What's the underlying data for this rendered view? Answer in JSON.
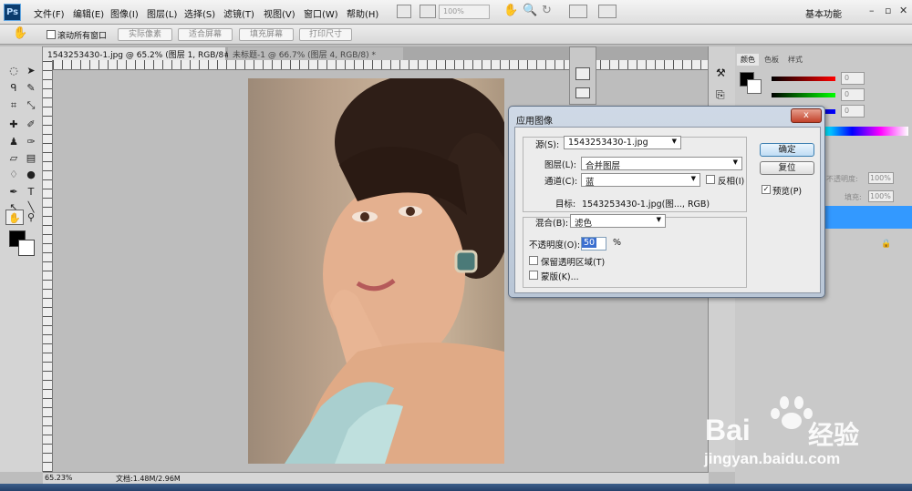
{
  "app": {
    "logo": "Ps",
    "workspace": "基本功能"
  },
  "menu": [
    "文件(F)",
    "编辑(E)",
    "图像(I)",
    "图层(L)",
    "选择(S)",
    "滤镜(T)",
    "视图(V)",
    "窗口(W)",
    "帮助(H)"
  ],
  "toolbar": {
    "zoom": "100%"
  },
  "options": {
    "scroll_all": "滚动所有窗口",
    "actual_pixels": "实际像素",
    "fit_screen": "适合屏幕",
    "fill_screen": "填充屏幕",
    "print_size": "打印尺寸"
  },
  "tabs": [
    {
      "label": "1543253430-1.jpg @ 65.2% (图层 1, RGB/8#) *"
    },
    {
      "label": "未标题-1 @ 66.7% (图层 4, RGB/8) *"
    }
  ],
  "status": {
    "zoom": "65.23%",
    "doc": "文档:1.48M/2.96M"
  },
  "panel": {
    "tabs": [
      "颜色",
      "色板",
      "样式"
    ],
    "values": [
      "0",
      "0",
      "0"
    ],
    "opacity_label": "不透明度:",
    "opacity_value": "100%",
    "fill_label": "填充:",
    "fill_value": "100%"
  },
  "dialog": {
    "title": "应用图像",
    "close": "x",
    "source_label": "源(S):",
    "source_value": "1543253430-1.jpg",
    "layer_label": "图层(L):",
    "layer_value": "合并图层",
    "channel_label": "通道(C):",
    "channel_value": "蓝",
    "invert_label": "反相(I)",
    "target_label": "目标:",
    "target_value": "1543253430-1.jpg(图..., RGB)",
    "blend_label": "混合(B):",
    "blend_value": "滤色",
    "opacity_label": "不透明度(O):",
    "opacity_value": "50",
    "opacity_unit": "%",
    "preserve_label": "保留透明区域(T)",
    "mask_label": "蒙版(K)...",
    "ok": "确定",
    "reset": "复位",
    "preview_label": "预览(P)",
    "preview_checked": true
  },
  "watermark": {
    "brand": "Bai",
    "brand2": "经验",
    "url": "jingyan.baidu.com"
  },
  "colors": {
    "accent": "#3399ff",
    "dialog_title": "#c4d0df",
    "close": "#c2412a"
  }
}
